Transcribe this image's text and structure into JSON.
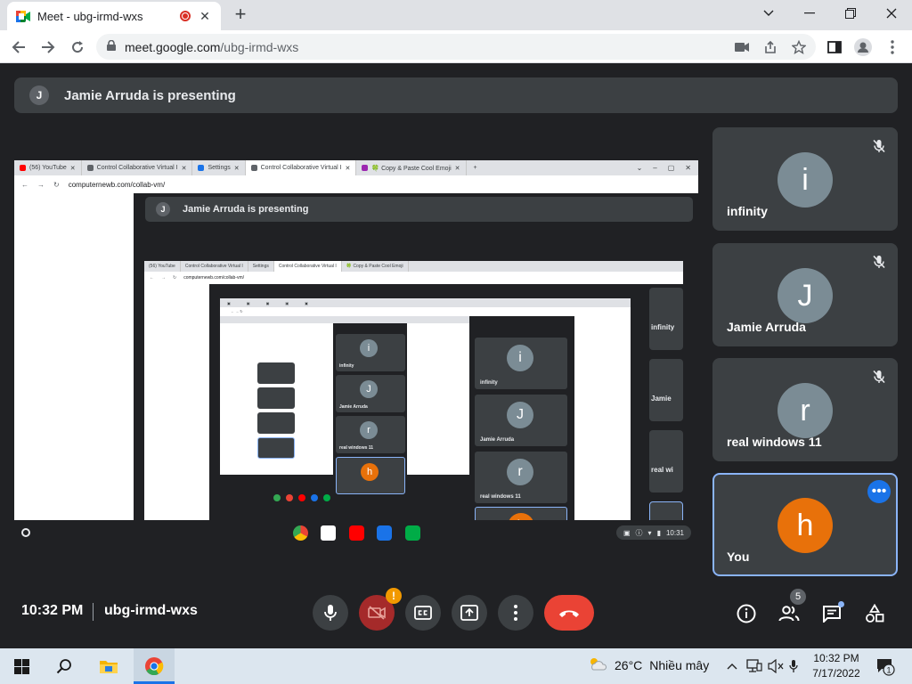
{
  "browser": {
    "tab_title": "Meet - ubg-irmd-wxs",
    "url_host": "meet.google.com",
    "url_path": "/ubg-irmd-wxs",
    "new_tab": "+",
    "tab_close": "✕"
  },
  "meeting": {
    "presenting_initial": "J",
    "presenting_text": "Jamie Arruda is presenting",
    "time": "10:32 PM",
    "code": "ubg-irmd-wxs",
    "participant_count": "5",
    "camera_warning": "!"
  },
  "participants": [
    {
      "initial": "i",
      "name": "infinity",
      "muted": true
    },
    {
      "initial": "J",
      "name": "Jamie Arruda",
      "muted": true
    },
    {
      "initial": "r",
      "name": "real windows 11",
      "muted": true
    },
    {
      "initial": "h",
      "name": "You",
      "muted": false
    }
  ],
  "shared_screen": {
    "tabs": [
      {
        "label": "(56) YouTube",
        "color": "#ff0000"
      },
      {
        "label": "Control Collaborative Virtual I",
        "color": "#5f6368"
      },
      {
        "label": "Settings",
        "color": "#1a73e8"
      },
      {
        "label": "Control Collaborative Virtual I",
        "color": "#5f6368",
        "active": true
      },
      {
        "label": "🍀 Copy & Paste Cool Emoji",
        "color": "#9c27b0"
      }
    ],
    "url": "computernewb.com/collab-vm/",
    "presenting_initial": "J",
    "presenting_text": "Jamie Arruda is presenting",
    "tray_time": "10:31",
    "level2": {
      "tabs": [
        "(56) YouTube",
        "Control Collaborative Virtual I",
        "Settings",
        "Control Collaborative Virtual I",
        "🍀 Copy & Paste Cool Emoji"
      ],
      "url": "computernewb.com/collab-vm/",
      "side_names": [
        "infinity",
        "Jamie",
        "real wi"
      ],
      "tiles": [
        {
          "initial": "i",
          "name": "infinity"
        },
        {
          "initial": "J",
          "name": "Jamie Arruda"
        },
        {
          "initial": "r",
          "name": "real windows 11"
        },
        {
          "initial": "h",
          "name": ""
        }
      ],
      "level3_tiles": [
        {
          "initial": "i",
          "name": "infinity"
        },
        {
          "initial": "J",
          "name": "Jamie Arruda"
        },
        {
          "initial": "r",
          "name": "real windows 11"
        },
        {
          "initial": "h",
          "name": ""
        }
      ]
    }
  },
  "taskbar": {
    "temperature": "26°C",
    "weather_text": "Nhiều mây",
    "time": "10:32 PM",
    "date": "7/17/2022",
    "notif_count": "1"
  },
  "colors": {
    "meet_bg": "#202124",
    "tile_bg": "#3c4043",
    "hangup": "#ea4335",
    "you_avatar": "#e8710a",
    "accent": "#8ab4f8"
  }
}
